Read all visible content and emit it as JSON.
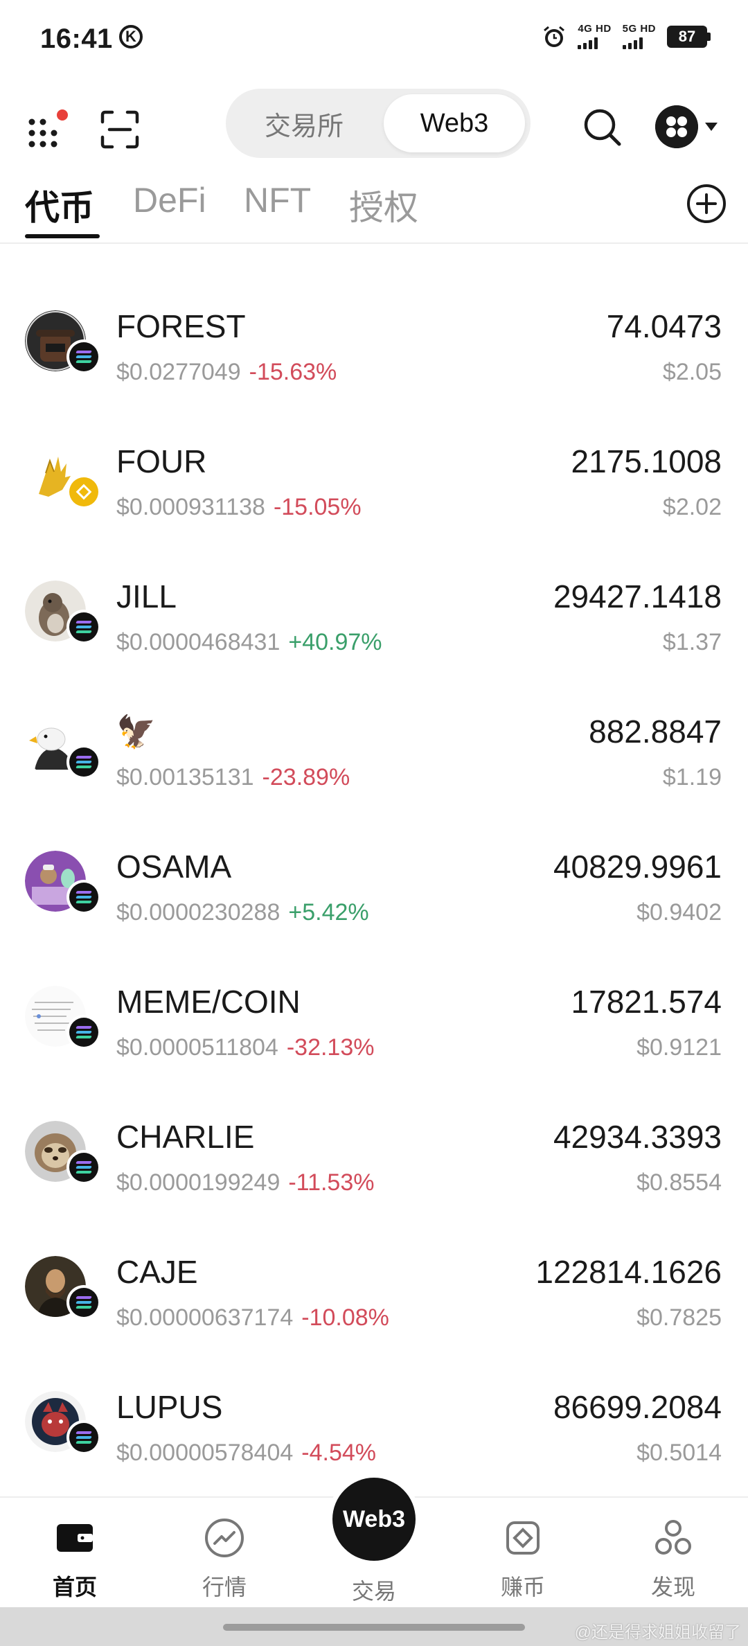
{
  "status_bar": {
    "time": "16:41",
    "k_badge": "K",
    "net1": "4G HD",
    "net2": "5G HD",
    "battery": "87"
  },
  "header": {
    "segment_tabs": [
      "交易所",
      "Web3"
    ],
    "active_segment": "Web3"
  },
  "sub_tabs": [
    "代币",
    "DeFi",
    "NFT",
    "授权"
  ],
  "active_sub_tab": "代币",
  "tokens": [
    {
      "name": "FOREST",
      "price": "$0.0277049",
      "change": "-15.63%",
      "direction": "neg",
      "balance": "74.0473",
      "value": "$2.05",
      "chain": "solana"
    },
    {
      "name": "FOUR",
      "price": "$0.000931138",
      "change": "-15.05%",
      "direction": "neg",
      "balance": "2175.1008",
      "value": "$2.02",
      "chain": "bnb"
    },
    {
      "name": "JILL",
      "price": "$0.0000468431",
      "change": "+40.97%",
      "direction": "pos",
      "balance": "29427.1418",
      "value": "$1.37",
      "chain": "solana"
    },
    {
      "name": "🦅",
      "price": "$0.00135131",
      "change": "-23.89%",
      "direction": "neg",
      "balance": "882.8847",
      "value": "$1.19",
      "chain": "solana"
    },
    {
      "name": "OSAMA",
      "price": "$0.0000230288",
      "change": "+5.42%",
      "direction": "pos",
      "balance": "40829.9961",
      "value": "$0.9402",
      "chain": "solana"
    },
    {
      "name": "MEME/COIN",
      "price": "$0.0000511804",
      "change": "-32.13%",
      "direction": "neg",
      "balance": "17821.574",
      "value": "$0.9121",
      "chain": "solana"
    },
    {
      "name": "CHARLIE",
      "price": "$0.0000199249",
      "change": "-11.53%",
      "direction": "neg",
      "balance": "42934.3393",
      "value": "$0.8554",
      "chain": "solana"
    },
    {
      "name": "CAJE",
      "price": "$0.00000637174",
      "change": "-10.08%",
      "direction": "neg",
      "balance": "122814.1626",
      "value": "$0.7825",
      "chain": "solana"
    },
    {
      "name": "LUPUS",
      "price": "$0.00000578404",
      "change": "-4.54%",
      "direction": "neg",
      "balance": "86699.2084",
      "value": "$0.5014",
      "chain": "solana"
    }
  ],
  "bottom_nav": {
    "items": [
      "首页",
      "行情",
      "交易",
      "赚币",
      "发现"
    ],
    "center_button": "Web3",
    "active": "首页"
  },
  "watermark": "@还是得求姐姐收留了",
  "colors": {
    "negative": "#d24b5a",
    "positive": "#3a9f6a",
    "notification_dot": "#e8403a"
  }
}
